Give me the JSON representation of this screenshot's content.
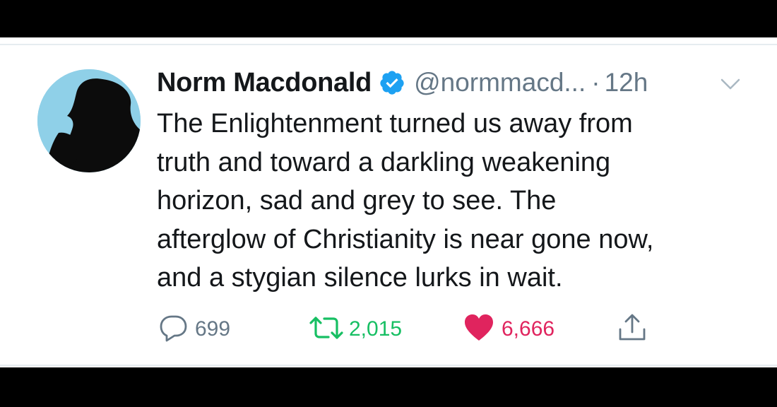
{
  "tweet": {
    "author_name": "Norm Macdonald",
    "handle": "@normmacd...",
    "separator": "·",
    "time": "12h",
    "text_lines": [
      "The Enlightenment turned us away from",
      "truth and toward a darkling weakening",
      "horizon, sad and grey to see. The",
      "afterglow of Christianity is near gone now,",
      "and a stygian silence lurks in wait."
    ]
  },
  "actions": {
    "replies": "699",
    "retweets": "2,015",
    "likes": "6,666"
  },
  "icons": {
    "avatar": "avatar-silhouette",
    "verified": "verified-badge-icon",
    "menu": "chevron-down-icon",
    "reply": "reply-bubble-icon",
    "retweet": "retweet-icon",
    "like": "heart-icon",
    "share": "share-icon"
  },
  "colors": {
    "verified_blue": "#1da1f2",
    "retweet_green": "#17bf63",
    "like_red": "#e0245e",
    "muted_gray": "#657786",
    "text": "#14171a"
  }
}
